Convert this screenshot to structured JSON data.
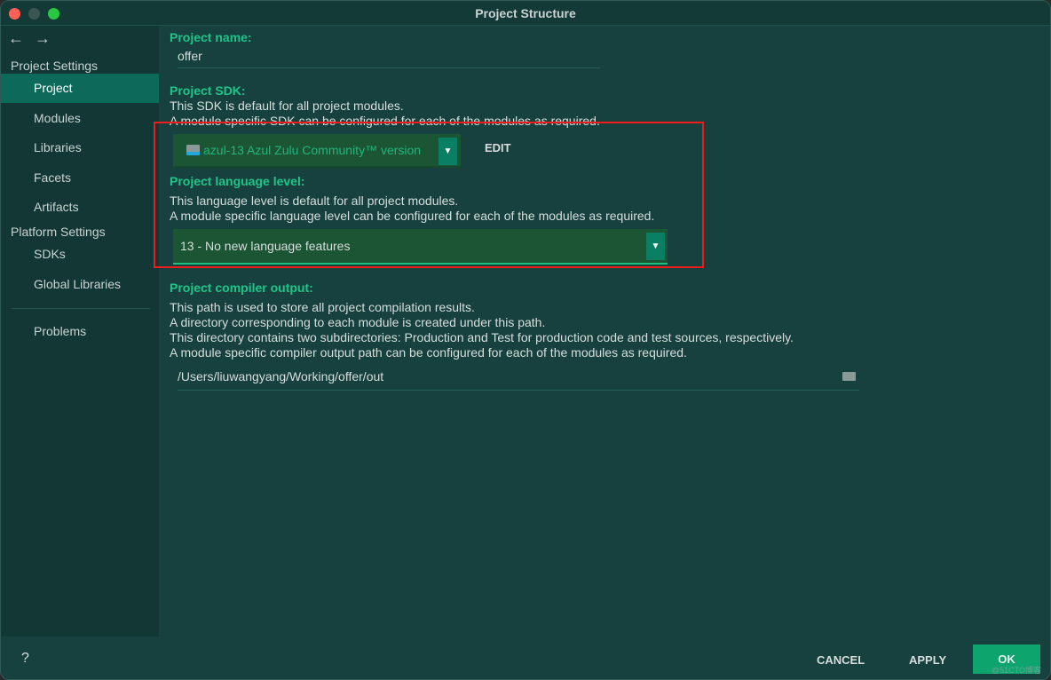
{
  "window": {
    "title": "Project Structure"
  },
  "sidebar": {
    "sections": [
      {
        "label": "Project Settings",
        "items": [
          {
            "label": "Project",
            "selected": true
          },
          {
            "label": "Modules"
          },
          {
            "label": "Libraries"
          },
          {
            "label": "Facets"
          },
          {
            "label": "Artifacts"
          }
        ]
      },
      {
        "label": "Platform Settings",
        "items": [
          {
            "label": "SDKs"
          },
          {
            "label": "Global Libraries"
          }
        ]
      }
    ],
    "problems": "Problems"
  },
  "main": {
    "name": {
      "label": "Project name:",
      "value": "offer"
    },
    "sdk": {
      "label": "Project SDK:",
      "desc": [
        "This SDK is default for all project modules.",
        "A module specific SDK can be configured for each of the modules as required."
      ],
      "value": "azul-13 Azul Zulu Community™ version",
      "edit": "EDIT"
    },
    "lang": {
      "label": "Project language level:",
      "desc": [
        "This language level is default for all project modules.",
        "A module specific language level can be configured for each of the modules as required."
      ],
      "value": "13 - No new language features"
    },
    "out": {
      "label": "Project compiler output:",
      "desc": [
        "This path is used to store all project compilation results.",
        "A directory corresponding to each module is created under this path.",
        "This directory contains two subdirectories: Production and Test for production code and test sources, respectively.",
        "A module specific compiler output path can be configured for each of the modules as required."
      ],
      "value": "/Users/liuwangyang/Working/offer/out"
    }
  },
  "footer": {
    "help": "?",
    "cancel": "CANCEL",
    "apply": "APPLY",
    "ok": "OK",
    "watermark": "@51CTO博客"
  },
  "colors": {
    "accent": "#1fc488",
    "highlight": "#ef1c1c",
    "ok": "#0ea46e"
  }
}
